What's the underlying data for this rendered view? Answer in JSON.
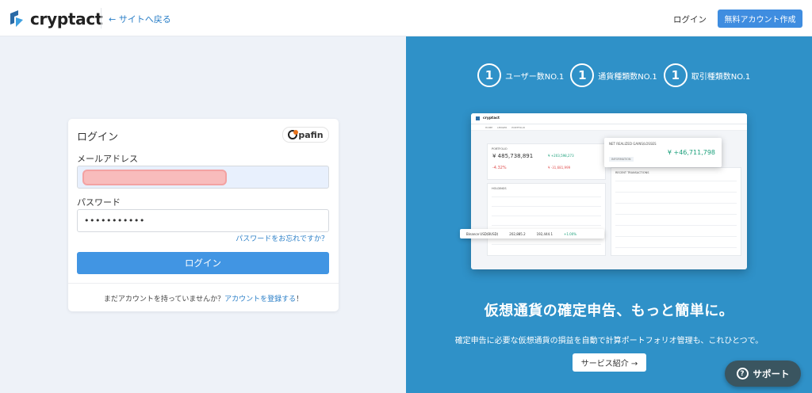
{
  "header": {
    "brand": "cryptact",
    "back_link": "← サイトへ戻る",
    "login": "ログイン",
    "signup": "無料アカウント作成"
  },
  "login_card": {
    "title": "ログイン",
    "partner_badge": "pafin",
    "email_label": "メールアドレス",
    "email_value": "",
    "password_label": "パスワード",
    "password_value": "•••••••••••",
    "forgot_link": "パスワードをお忘れですか？",
    "submit": "ログイン",
    "register_prefix": "まだアカウントを持っていませんか？",
    "register_link": "アカウントを登録する",
    "register_suffix": "！"
  },
  "promo": {
    "awards": [
      {
        "rank": "1",
        "label": "ユーザー数NO.1"
      },
      {
        "rank": "1",
        "label": "通貨種類数NO.1"
      },
      {
        "rank": "1",
        "label": "取引種類数NO.1"
      }
    ],
    "mock": {
      "brand": "cryptact",
      "tabs": [
        "HOME",
        "LEDGER",
        "PORTFOLIO"
      ],
      "portfolio_title": "PORTFOLIO",
      "portfolio_value": "¥ 485,738,891",
      "portfolio_gain": "¥ +203,598,273",
      "portfolio_pct": "-4.32%",
      "portfolio_loss": "¥ -31,681,999",
      "realized_title": "NET REALIZED GAINS/LOSSES",
      "realized_value": "¥ +46,711,798",
      "realized_info": "INFORMATION",
      "holdings_title": "HOLDINGS",
      "transactions_title": "RECENT TRANSACTIONS",
      "strip_coin": "Binance USD(BUSD)",
      "strip_amount": "202,885.2",
      "strip_value": "192,444.1",
      "strip_pct": "+1.00%"
    },
    "tagline": "仮想通貨の確定申告、もっと簡単に。",
    "subline": "確定申告に必要な仮想通貨の損益を自動で計算ポートフォリオ管理も、これひとつで。",
    "service_button": "サービス紹介 →"
  },
  "support": {
    "label": "サポート",
    "icon": "?"
  },
  "colors": {
    "primary_button": "#4195e3",
    "promo_bg": "#2f91c8",
    "left_bg": "#eef2f8",
    "support_bg": "#3a5560"
  }
}
